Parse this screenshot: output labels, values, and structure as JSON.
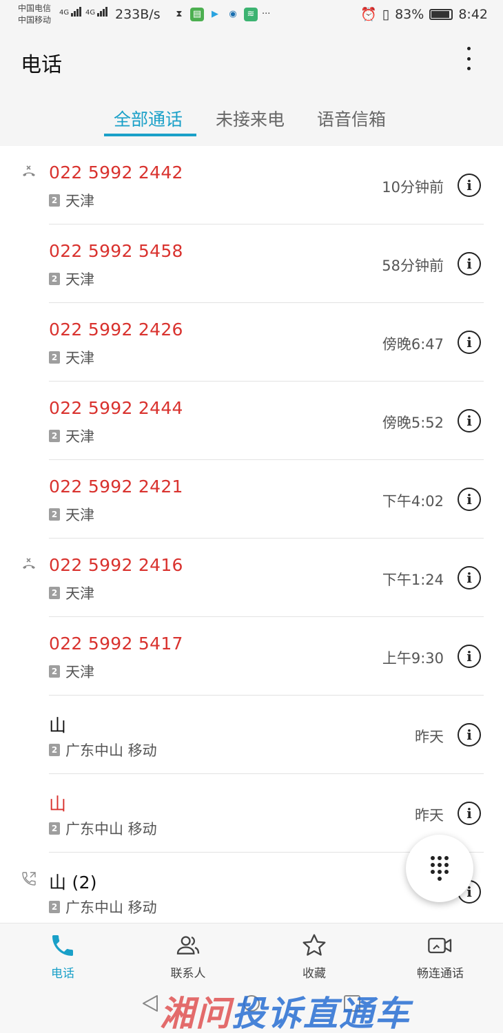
{
  "status_bar": {
    "carrier_1": "中国电信",
    "carrier_2": "中国移动",
    "net_type": "4G",
    "net_speed": "233B/s",
    "more": "···",
    "battery": "83%",
    "time": "8:42"
  },
  "app_bar": {
    "title": "电话",
    "menu_icon": "more-vert-icon"
  },
  "tabs": [
    {
      "label": "全部通话",
      "active": true
    },
    {
      "label": "未接来电",
      "active": false
    },
    {
      "label": "语音信箱",
      "active": false
    }
  ],
  "calls": [
    {
      "name": "022 5992 2442",
      "sim": "2",
      "location": "天津",
      "time": "10分钟前",
      "missed": true,
      "type_icon": "rejected-call-icon"
    },
    {
      "name": "022 5992 5458",
      "sim": "2",
      "location": "天津",
      "time": "58分钟前",
      "missed": true,
      "type_icon": ""
    },
    {
      "name": "022 5992 2426",
      "sim": "2",
      "location": "天津",
      "time": "傍晚6:47",
      "missed": true,
      "type_icon": ""
    },
    {
      "name": "022 5992 2444",
      "sim": "2",
      "location": "天津",
      "time": "傍晚5:52",
      "missed": true,
      "type_icon": ""
    },
    {
      "name": "022 5992 2421",
      "sim": "2",
      "location": "天津",
      "time": "下午4:02",
      "missed": true,
      "type_icon": ""
    },
    {
      "name": "022 5992 2416",
      "sim": "2",
      "location": "天津",
      "time": "下午1:24",
      "missed": true,
      "type_icon": "rejected-call-icon"
    },
    {
      "name": "022 5992 5417",
      "sim": "2",
      "location": "天津",
      "time": "上午9:30",
      "missed": true,
      "type_icon": ""
    },
    {
      "name": "山",
      "sim": "2",
      "location": "广东中山 移动",
      "time": "昨天",
      "missed": false,
      "type_icon": ""
    },
    {
      "name": "山",
      "sim": "2",
      "location": "广东中山 移动",
      "time": "昨天",
      "missed": true,
      "type_icon": ""
    },
    {
      "name": "山 (2)",
      "sim": "2",
      "location": "广东中山 移动",
      "time": "昨",
      "missed": false,
      "type_icon": "outgoing-call-icon"
    }
  ],
  "fab": {
    "icon": "dialpad-icon"
  },
  "bottom_nav": [
    {
      "label": "电话",
      "icon": "phone-icon",
      "active": true
    },
    {
      "label": "联系人",
      "icon": "contacts-icon",
      "active": false
    },
    {
      "label": "收藏",
      "icon": "star-icon",
      "active": false
    },
    {
      "label": "畅连通话",
      "icon": "video-call-icon",
      "active": false
    }
  ],
  "watermark": {
    "part1": "湘问",
    "part2": "投诉直通车"
  },
  "colors": {
    "accent": "#1aa0c8",
    "missed": "#d9322e"
  }
}
